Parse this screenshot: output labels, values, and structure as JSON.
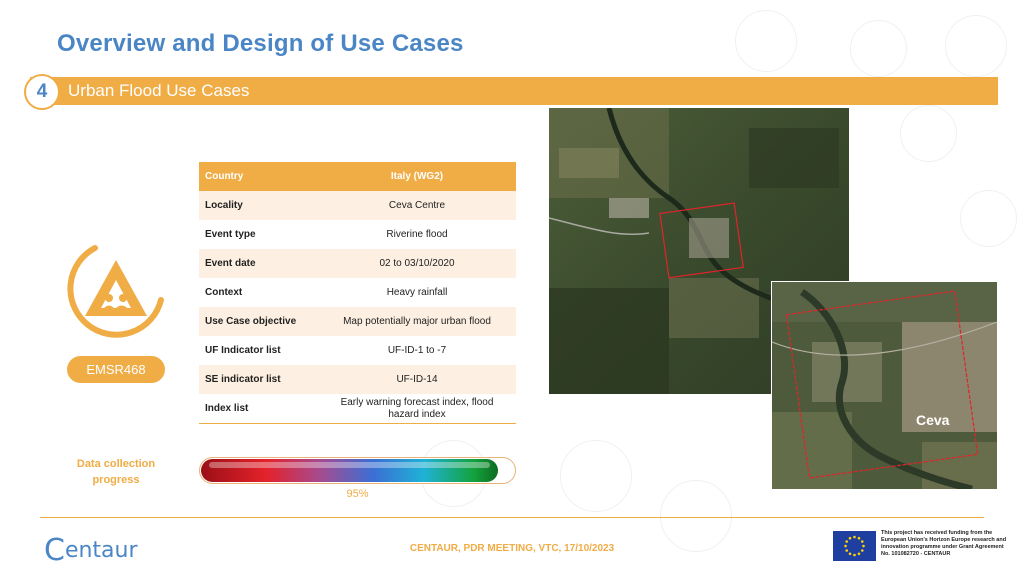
{
  "slide": {
    "title": "Overview and Design of Use Cases",
    "section_number": "4",
    "section_title": "Urban Flood Use Cases"
  },
  "emsr_badge": "EMSR468",
  "table": {
    "header": {
      "key": "Country",
      "value": "Italy (WG2)"
    },
    "rows": [
      {
        "key": "Locality",
        "value": "Ceva Centre"
      },
      {
        "key": "Event type",
        "value": "Riverine flood"
      },
      {
        "key": "Event date",
        "value": "02 to 03/10/2020"
      },
      {
        "key": "Context",
        "value": "Heavy rainfall"
      },
      {
        "key": "Use Case objective",
        "value": "Map potentially major urban flood"
      },
      {
        "key": "UF Indicator list",
        "value": "UF-ID-1 to -7"
      },
      {
        "key": "SE indicator list",
        "value": "UF-ID-14"
      },
      {
        "key": "Index list",
        "value": "Early warning forecast index, flood hazard index"
      }
    ]
  },
  "progress": {
    "label": "Data collection progress",
    "value_text": "95%",
    "value": 0.95
  },
  "map": {
    "place_label": "Ceva"
  },
  "footer": {
    "meeting": "CENTAUR, PDR MEETING, VTC, 17/10/2023",
    "brand": "entaur",
    "eu_notice": "This project has received funding from the European Union's Horizon Europe research and innovation programme under Grant Agreement No. 101082720 - CENTAUR"
  },
  "colors": {
    "accent": "#f0ac45",
    "title_blue": "#4a86c5",
    "frame_red": "#e0242b"
  }
}
